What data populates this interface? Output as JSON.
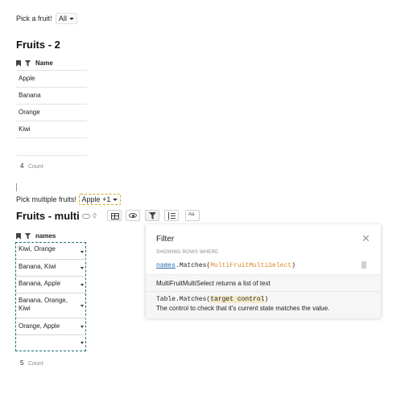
{
  "fruit_picker": {
    "label": "Pick a fruit!",
    "value": "All"
  },
  "section1": {
    "title": "Fruits - 2",
    "column": "Name",
    "rows": [
      "Apple",
      "Banana",
      "Orange",
      "Kiwi"
    ],
    "count_value": "4",
    "count_label": "Count"
  },
  "multi_picker": {
    "label": "Pick multiple fruits!",
    "value": "Apple +1"
  },
  "section2": {
    "title": "Fruits - multi",
    "link_count": "0",
    "column": "names",
    "rows": [
      "Kiwi, Orange",
      "Banana, Kiwi",
      "Banana, Apple",
      "Banana, Orange, Kiwi",
      "Orange, Apple",
      ""
    ],
    "count_value": "5",
    "count_label": "Count",
    "toolbar": {
      "text_icon_label": "Aa"
    }
  },
  "filter_panel": {
    "title": "Filter",
    "subtitle": "SHOWING ROWS WHERE",
    "expr_column": "names",
    "expr_method": ".Matches(",
    "expr_arg": "MultiFruitMultiSelect",
    "expr_close": ")",
    "hint": "MultiFruitMultiSelect returns a list of text",
    "sig_prefix": "Table.Matches(",
    "sig_arg": "target control",
    "sig_close": ")",
    "sig_desc": "The control to check that it's current state matches the value."
  },
  "colors": {
    "accent_teal": "#1f6e78",
    "accent_orange": "#d8a21c",
    "formula_orange": "#e0892a",
    "link_blue": "#2a6ab8"
  }
}
